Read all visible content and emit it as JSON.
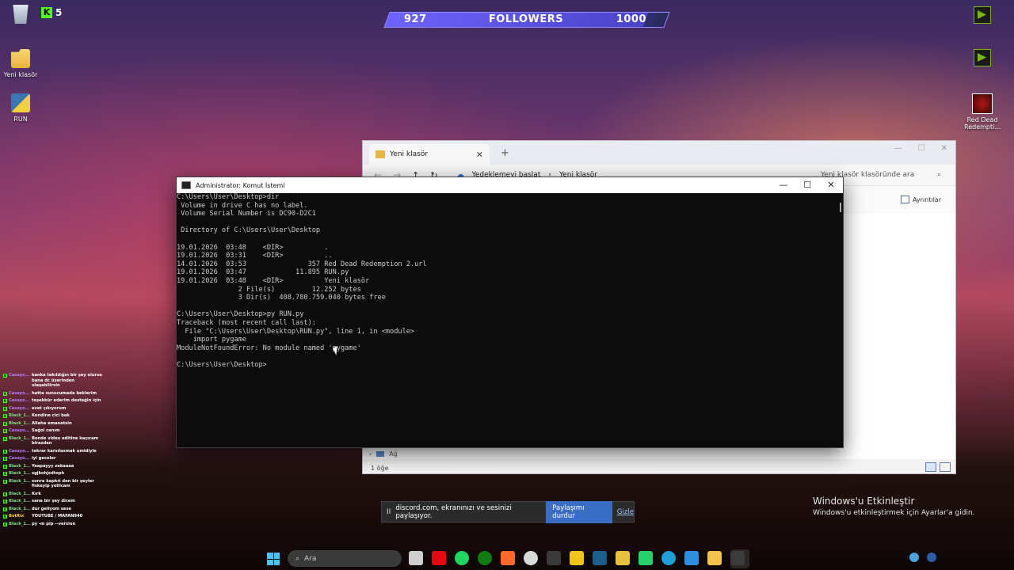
{
  "desktop": {
    "icons_left": [
      {
        "label": "Yeni klasör"
      },
      {
        "label": "RUN"
      }
    ],
    "kick_count": "5",
    "icons_right": [
      {
        "label": "Red Dead Redempti..."
      }
    ]
  },
  "followers_goal": {
    "current": "927",
    "label": "FOLLOWERS",
    "target": "1000",
    "progress": 0.927
  },
  "explorer": {
    "tab_title": "Yeni klasör",
    "breadcrumb": [
      "Yedeklemeyi başlat",
      "Yeni klasör"
    ],
    "search_placeholder": "Yeni klasör klasöründe ara",
    "details_label": "Ayrıntılar",
    "tree_item": "Ağ",
    "status": "1 öğe"
  },
  "console": {
    "title": "Administrator: Komut İstemi",
    "lines": [
      "C:\\Users\\User\\Desktop>dir",
      " Volume in drive C has no label.",
      " Volume Serial Number is DC90-D2C1",
      "",
      " Directory of C:\\Users\\User\\Desktop",
      "",
      "19.01.2026  03:48    <DIR>          .",
      "19.01.2026  03:31    <DIR>          ..",
      "14.01.2026  03:53               357 Red Dead Redemption 2.url",
      "19.01.2026  03:47            11.895 RUN.py",
      "19.01.2026  03:48    <DIR>          Yeni klasör",
      "               2 File(s)         12.252 bytes",
      "               3 Dir(s)  408.780.759.040 bytes free",
      "",
      "C:\\Users\\User\\Desktop>py RUN.py",
      "Traceback (most recent call last):",
      "  File \"C:\\Users\\User\\Desktop\\RUN.py\", line 1, in <module>",
      "    import pygame",
      "ModuleNotFoundError: No module named 'pygame'",
      "",
      "C:\\Users\\User\\Desktop>"
    ]
  },
  "chat": [
    {
      "user": "Casayo...",
      "msg": "kanka takıldığın bir şey olursa bana dc üzerinden ulaşabilirsin",
      "color": "#b57bff"
    },
    {
      "user": "Casayo...",
      "msg": "hatta sunucumada beklerim",
      "color": "#b57bff"
    },
    {
      "user": "Casayo...",
      "msg": "teşekkür ederim desteğin için",
      "color": "#b57bff"
    },
    {
      "user": "Casayo...",
      "msg": "evet çıkıyorum",
      "color": "#b57bff"
    },
    {
      "user": "Black_1...",
      "msg": "Kendine cici bak",
      "color": "#7ee08a"
    },
    {
      "user": "Black_1...",
      "msg": "Allaha emanetsin",
      "color": "#7ee08a"
    },
    {
      "user": "Casayo...",
      "msg": "Sağol canım",
      "color": "#b57bff"
    },
    {
      "user": "Black_1...",
      "msg": "Bende video editine kaçıcam birazdan",
      "color": "#7ee08a"
    },
    {
      "user": "Casayo...",
      "msg": "tekrar karsılasmak umidiyle",
      "color": "#b57bff"
    },
    {
      "user": "Casayo...",
      "msg": "iyi geceler",
      "color": "#b57bff"
    },
    {
      "user": "Black_1...",
      "msg": "Yaapayyy zekaaaa",
      "color": "#7ee08a"
    },
    {
      "user": "Black_1...",
      "msg": "sgjkohjsdtoph",
      "color": "#7ee08a"
    },
    {
      "user": "Black_1...",
      "msg": "sonra kapkıt den bir şeyler fiskeyip yollicam",
      "color": "#7ee08a"
    },
    {
      "user": "Black_1...",
      "msg": "Kırk",
      "color": "#7ee08a"
    },
    {
      "user": "Black_1...",
      "msg": "sana bir şey dicem",
      "color": "#7ee08a"
    },
    {
      "user": "Black_1...",
      "msg": "dur geliyom sese",
      "color": "#7ee08a"
    },
    {
      "user": "BotRix",
      "msg": "YOUTUBE / MAFAN940",
      "color": "#ffd24a"
    },
    {
      "user": "Black_1...",
      "msg": "py -m pip --version",
      "color": "#7ee08a"
    }
  ],
  "share_bar": {
    "message": "discord.com, ekranınızı ve sesinizi paylaşıyor.",
    "stop_button": "Paylaşımı durdur",
    "hide_link": "Gizle"
  },
  "activation": {
    "title": "Windows'u Etkinleştir",
    "subtitle": "Windows'u etkinleştirmek için Ayarlar'a gidin."
  },
  "taskbar": {
    "search_placeholder": "Ara",
    "apps": [
      "file-icon",
      "netflix-icon",
      "spotify-icon",
      "xbox-icon",
      "record-icon",
      "obs-icon",
      "epic-icon",
      "game-icon",
      "steam-icon",
      "chrome-icon",
      "whatsapp-icon",
      "edge-icon",
      "vscode-icon",
      "explorer-icon",
      "terminal-icon"
    ]
  }
}
